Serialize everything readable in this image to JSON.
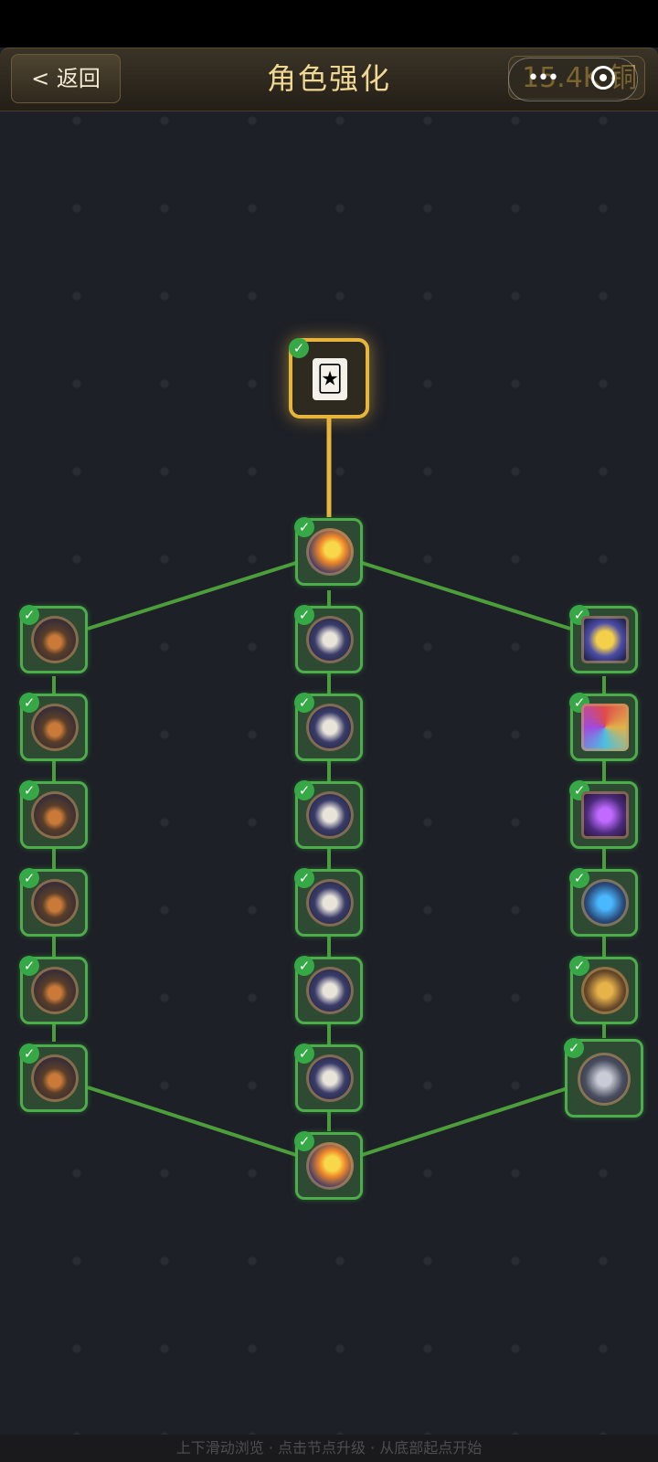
{
  "header": {
    "back_label": "< 返回",
    "title": "角色强化",
    "currency_text": "15.4K 铜",
    "menu_dots": "•••"
  },
  "skill_tree": {
    "root": {
      "emoji": "🃏",
      "status": "completed"
    },
    "top_hub": {
      "icon": "star-icon",
      "status": "completed"
    },
    "bottom_hub": {
      "icon": "star-icon",
      "status": "completed"
    },
    "left_column": [
      {
        "icon": "rocket-chest-icon",
        "status": "completed"
      },
      {
        "icon": "rocket-chest-icon",
        "status": "completed"
      },
      {
        "icon": "rocket-chest-icon",
        "status": "completed"
      },
      {
        "icon": "rocket-chest-icon",
        "status": "completed"
      },
      {
        "icon": "rocket-chest-icon",
        "status": "completed"
      },
      {
        "icon": "rocket-chest-icon",
        "status": "completed"
      }
    ],
    "middle_column": [
      {
        "icon": "bone-icon",
        "status": "completed"
      },
      {
        "icon": "bone-icon",
        "status": "completed"
      },
      {
        "icon": "bone-icon",
        "status": "completed"
      },
      {
        "icon": "bone-icon",
        "status": "completed"
      },
      {
        "icon": "bone-icon",
        "status": "completed"
      },
      {
        "icon": "bone-icon",
        "status": "completed"
      }
    ],
    "right_column": [
      {
        "icon": "crown-icon",
        "status": "completed"
      },
      {
        "icon": "rainbow-bone-icon",
        "status": "completed"
      },
      {
        "icon": "purple-bone-icon",
        "status": "completed"
      },
      {
        "icon": "blue-bone-icon",
        "status": "completed"
      },
      {
        "icon": "golden-bone-icon",
        "status": "completed"
      },
      {
        "icon": "crossed-bones-icon",
        "status": "completed"
      }
    ]
  },
  "check_mark": "✓",
  "footer": {
    "hint": "上下滑动浏览 · 点击节点升级 · 从底部起点开始"
  },
  "colors": {
    "completed_border": "#4cae4a",
    "root_border": "#e7b53c",
    "title": "#f1d892",
    "link_green": "#4c9e3a",
    "link_gold": "#e7b53c"
  }
}
